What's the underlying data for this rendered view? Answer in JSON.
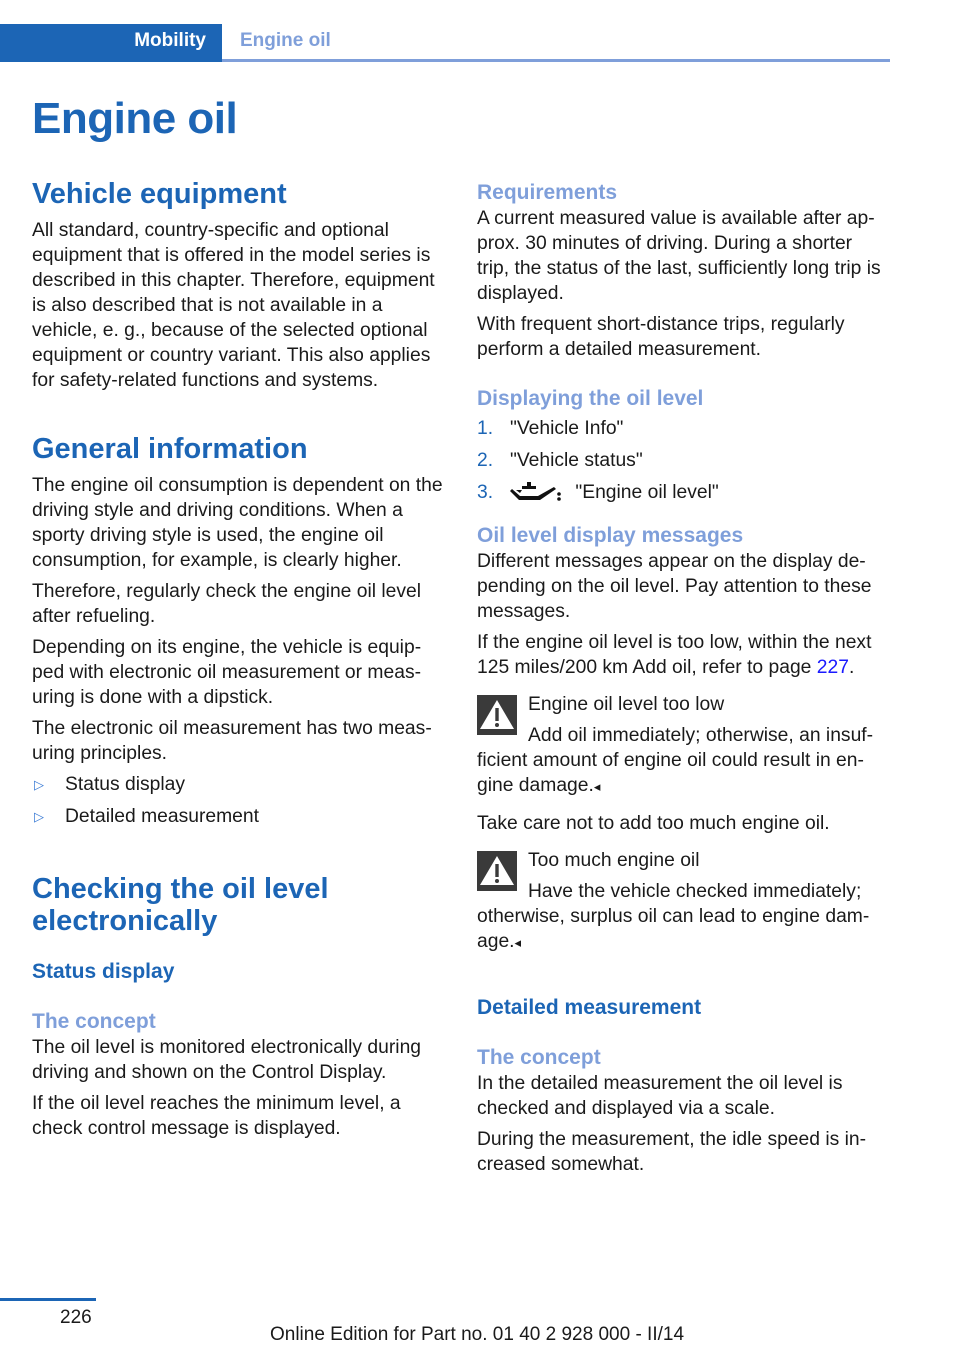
{
  "header": {
    "section": "Mobility",
    "chapter": "Engine oil"
  },
  "title": "Engine oil",
  "colors": {
    "primary_blue": "#1c65b5",
    "light_blue": "#7f9fda",
    "link_blue": "#1a1aff",
    "text": "#1a1a1a",
    "warning_icon_bg": "#3a3a3a"
  },
  "left": {
    "vehicle_equipment": {
      "heading": "Vehicle equipment",
      "text": "All standard, country-specific and optional equipment that is offered in the model series is described in this chapter. Therefore, equip­ment is also described that is not available in a vehicle, e. g., because of the selected optional equipment or country variant. This also applies for safety-related functions and systems."
    },
    "general_information": {
      "heading": "General information",
      "paragraphs": [
        "The engine oil consumption is dependent on the driving style and driving conditions. When a sporty driving style is used, the engine oil consumption, for example, is clearly higher.",
        "Therefore, regularly check the engine oil level after refueling.",
        "Depending on its engine, the vehicle is equip­ped with electronic oil measurement or meas­uring is done with a dipstick.",
        "The electronic oil measurement has two meas­uring principles."
      ],
      "bullet_icon": "triangle-right-outline-icon",
      "bullets": [
        "Status display",
        "Detailed measurement"
      ]
    },
    "checking": {
      "heading": "Checking the oil level electronically",
      "status_display": {
        "heading": "Status display",
        "concept_heading": "The concept",
        "paragraphs": [
          "The oil level is monitored electronically during driving and shown on the Control Display.",
          "If the oil level reaches the minimum level, a check control message is displayed."
        ]
      }
    }
  },
  "right": {
    "requirements": {
      "heading": "Requirements",
      "paragraphs": [
        "A current measured value is available after ap­prox. 30 minutes of driving. During a shorter trip, the status of the last, sufficiently long trip is displayed.",
        "With frequent short-distance trips, regularly perform a detailed measurement."
      ]
    },
    "displaying": {
      "heading": "Displaying the oil level",
      "steps": [
        {
          "num": "1.",
          "text": "\"Vehicle Info\""
        },
        {
          "num": "2.",
          "text": "\"Vehicle status\""
        },
        {
          "num": "3.",
          "icon": "oil-can-icon",
          "text": "\"Engine oil level\""
        }
      ]
    },
    "messages": {
      "heading": "Oil level display messages",
      "paragraph1": "Different messages appear on the display de­pending on the oil level. Pay attention to these messages.",
      "paragraph2_prefix": "If the engine oil level is too low, within the next 125 miles/200 km Add oil, refer to page ",
      "paragraph2_link": "227",
      "paragraph2_suffix": ".",
      "warning1": {
        "title": "Engine oil level too low",
        "text": "Add oil immediately; otherwise, an insuf­ficient amount of engine oil could result in en­gine damage.",
        "end_mark": "◂"
      },
      "between": "Take care not to add too much engine oil.",
      "warning2": {
        "title": "Too much engine oil",
        "text": "Have the vehicle checked immediately; otherwise, surplus oil can lead to engine dam­age.",
        "end_mark": "◂"
      }
    },
    "detailed": {
      "heading": "Detailed measurement",
      "concept_heading": "The concept",
      "paragraphs": [
        "In the detailed measurement the oil level is checked and displayed via a scale.",
        "During the measurement, the idle speed is in­creased somewhat."
      ]
    }
  },
  "footer": {
    "page_number": "226",
    "edition": "Online Edition for Part no. 01 40 2 928 000 - II/14"
  }
}
